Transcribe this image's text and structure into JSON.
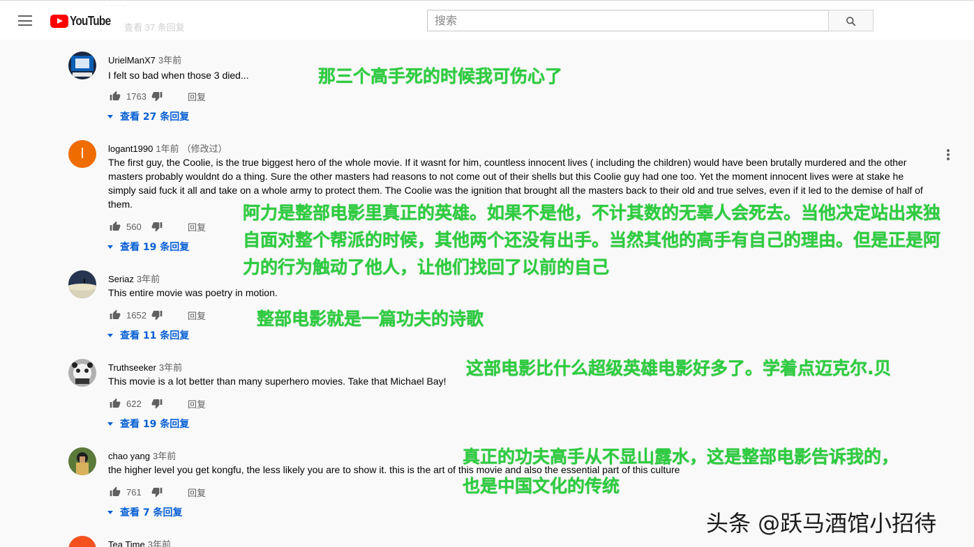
{
  "header": {
    "logo_text": "YouTube",
    "search_placeholder": "搜索",
    "ghost_above": "· · · ·",
    "ghost_replies": "查看 37 条回复"
  },
  "comments": [
    {
      "author": "UrielManX7",
      "time": "3年前",
      "edited": "",
      "text": "I felt so bad when those 3 died...",
      "likes": "1763",
      "reply_label": "回复",
      "view_replies": "查看 27 条回复",
      "avatar_color": "#1d2a45"
    },
    {
      "author": "logant1990",
      "time": "1年前",
      "edited": "（修改过）",
      "text": "The first guy, the Coolie, is the true biggest hero of the whole movie. If it wasnt for him, countless innocent lives ( including the children) would have been brutally murdered and the other masters probably wouldnt do a thing. Sure the other masters had reasons to not come out of their shells but this Coolie guy had one too. Yet the moment innocent lives were at stake he simply said fuck it all and take on a whole army to protect them. The Coolie was the ignition that brought all the masters back to their old and true selves, even if it led to the demise of half of them.",
      "likes": "560",
      "reply_label": "回复",
      "view_replies": "查看 19 条回复",
      "avatar_letter": "l",
      "avatar_color": "#ef6c00"
    },
    {
      "author": "Seriaz",
      "time": "3年前",
      "edited": "",
      "text": "This entire movie was poetry in motion.",
      "likes": "1652",
      "reply_label": "回复",
      "view_replies": "查看 11 条回复",
      "avatar_color": "#2b3a55"
    },
    {
      "author": "Truthseeker",
      "time": "3年前",
      "edited": "",
      "text": "This movie is a lot better than many superhero movies. Take that Michael Bay!",
      "likes": "622",
      "reply_label": "回复",
      "view_replies": "查看 19 条回复",
      "avatar_color": "#8a8a8a"
    },
    {
      "author": "chao yang",
      "time": "3年前",
      "edited": "",
      "text": "the higher level you get kongfu, the less likely you are to show it. this is the art of this movie and also the essential part of this culture",
      "likes": "761",
      "reply_label": "回复",
      "view_replies": "查看 7 条回复",
      "avatar_color": "#3b5b2e"
    },
    {
      "author": "Tea Time",
      "time": "3年前",
      "edited": "",
      "avatar_color": "#f4511e"
    }
  ],
  "annotations": [
    "那三个高手死的时候我可伤心了",
    "阿力是整部电影里真正的英雄。如果不是他，不计其数的无辜人会死去。当他决定站出来独",
    "自面对整个帮派的时候，其他两个还没有出手。当然其他的高手有自己的理由。但是正是阿",
    "力的行为触动了他人，让他们找回了以前的自己",
    "整部电影就是一篇功夫的诗歌",
    "这部电影比什么超级英雄电影好多了。学着点迈克尔.贝",
    "真正的功夫高手从不显山露水，这是整部电影告诉我的，",
    "也是中国文化的传统"
  ],
  "watermark": "头条 @跃马酒馆小招待",
  "colors": {
    "annotation": "#2ecc40",
    "link": "#065fd4",
    "brand": "#ff0000"
  }
}
